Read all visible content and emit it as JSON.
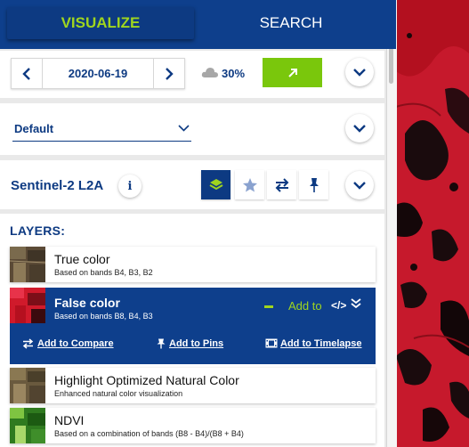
{
  "tabs": [
    {
      "label": "VISUALIZE",
      "active": true
    },
    {
      "label": "SEARCH",
      "active": false
    }
  ],
  "date": {
    "value": "2020-06-19",
    "prev_icon": "chevron-left-icon",
    "next_icon": "chevron-right-icon"
  },
  "cloud_coverage": {
    "value": "30%",
    "icon": "cloud-icon"
  },
  "theme": {
    "selected": "Default"
  },
  "datasource": {
    "name": "Sentinel-2 L2A"
  },
  "layers": {
    "title": "LAYERS:",
    "items": [
      {
        "name": "True color",
        "description": "Based on bands B4, B3, B2",
        "active": false
      },
      {
        "name": "False color",
        "description": "Based on bands B8, B4, B3",
        "active": true
      },
      {
        "name": "Highlight Optimized Natural Color",
        "description": "Enhanced natural color visualization",
        "active": false
      },
      {
        "name": "NDVI",
        "description": "Based on a combination of bands (B8 - B4)/(B8 + B4)",
        "active": false
      }
    ],
    "active_actions": {
      "add_to": "Add to",
      "compare": "Add to Compare",
      "pins": "Add to Pins",
      "timelapse": "Add to Timelapse"
    }
  },
  "colors": {
    "brand_blue": "#0e3f8c",
    "accent_green": "#9fd51f",
    "button_green": "#7ac70c",
    "map_red": "#c4162a"
  }
}
